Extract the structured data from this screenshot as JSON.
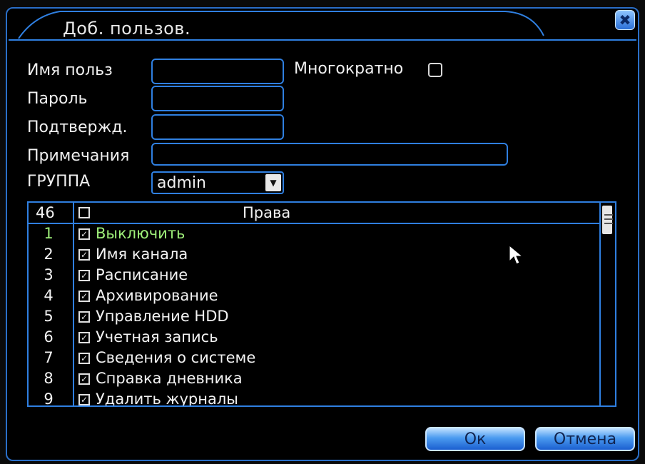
{
  "dialog": {
    "title": "Доб. пользов.",
    "close_glyph": "✖"
  },
  "form": {
    "username_label": "Имя польз",
    "username_value": "",
    "multiple_label": "Многократно",
    "password_label": "Пароль",
    "password_value": "",
    "confirm_label": "Подтвержд.",
    "confirm_value": "",
    "notes_label": "Примечания",
    "notes_value": "",
    "group_label": "ГРУППА",
    "group_value": "admin"
  },
  "permissions": {
    "count": "46",
    "header": "Права",
    "items": [
      {
        "num": "1",
        "label": "Выключить",
        "checked": true
      },
      {
        "num": "2",
        "label": "Имя канала",
        "checked": true
      },
      {
        "num": "3",
        "label": "Расписание",
        "checked": true
      },
      {
        "num": "4",
        "label": "Архивирование",
        "checked": true
      },
      {
        "num": "5",
        "label": "Управление HDD",
        "checked": true
      },
      {
        "num": "6",
        "label": "Учетная запись",
        "checked": true
      },
      {
        "num": "7",
        "label": "Сведения о системе",
        "checked": true
      },
      {
        "num": "8",
        "label": "Справка дневника",
        "checked": true
      },
      {
        "num": "9",
        "label": "Удалить журналы",
        "checked": true
      }
    ]
  },
  "buttons": {
    "ok": "Ок",
    "cancel": "Отмена"
  },
  "colors": {
    "accent": "#2f7fe0",
    "active_row": "#9ff07a",
    "background": "#000000"
  },
  "icons": {
    "close": "close-icon",
    "dropdown": "chevron-down-icon",
    "cursor": "mouse-pointer-icon"
  }
}
